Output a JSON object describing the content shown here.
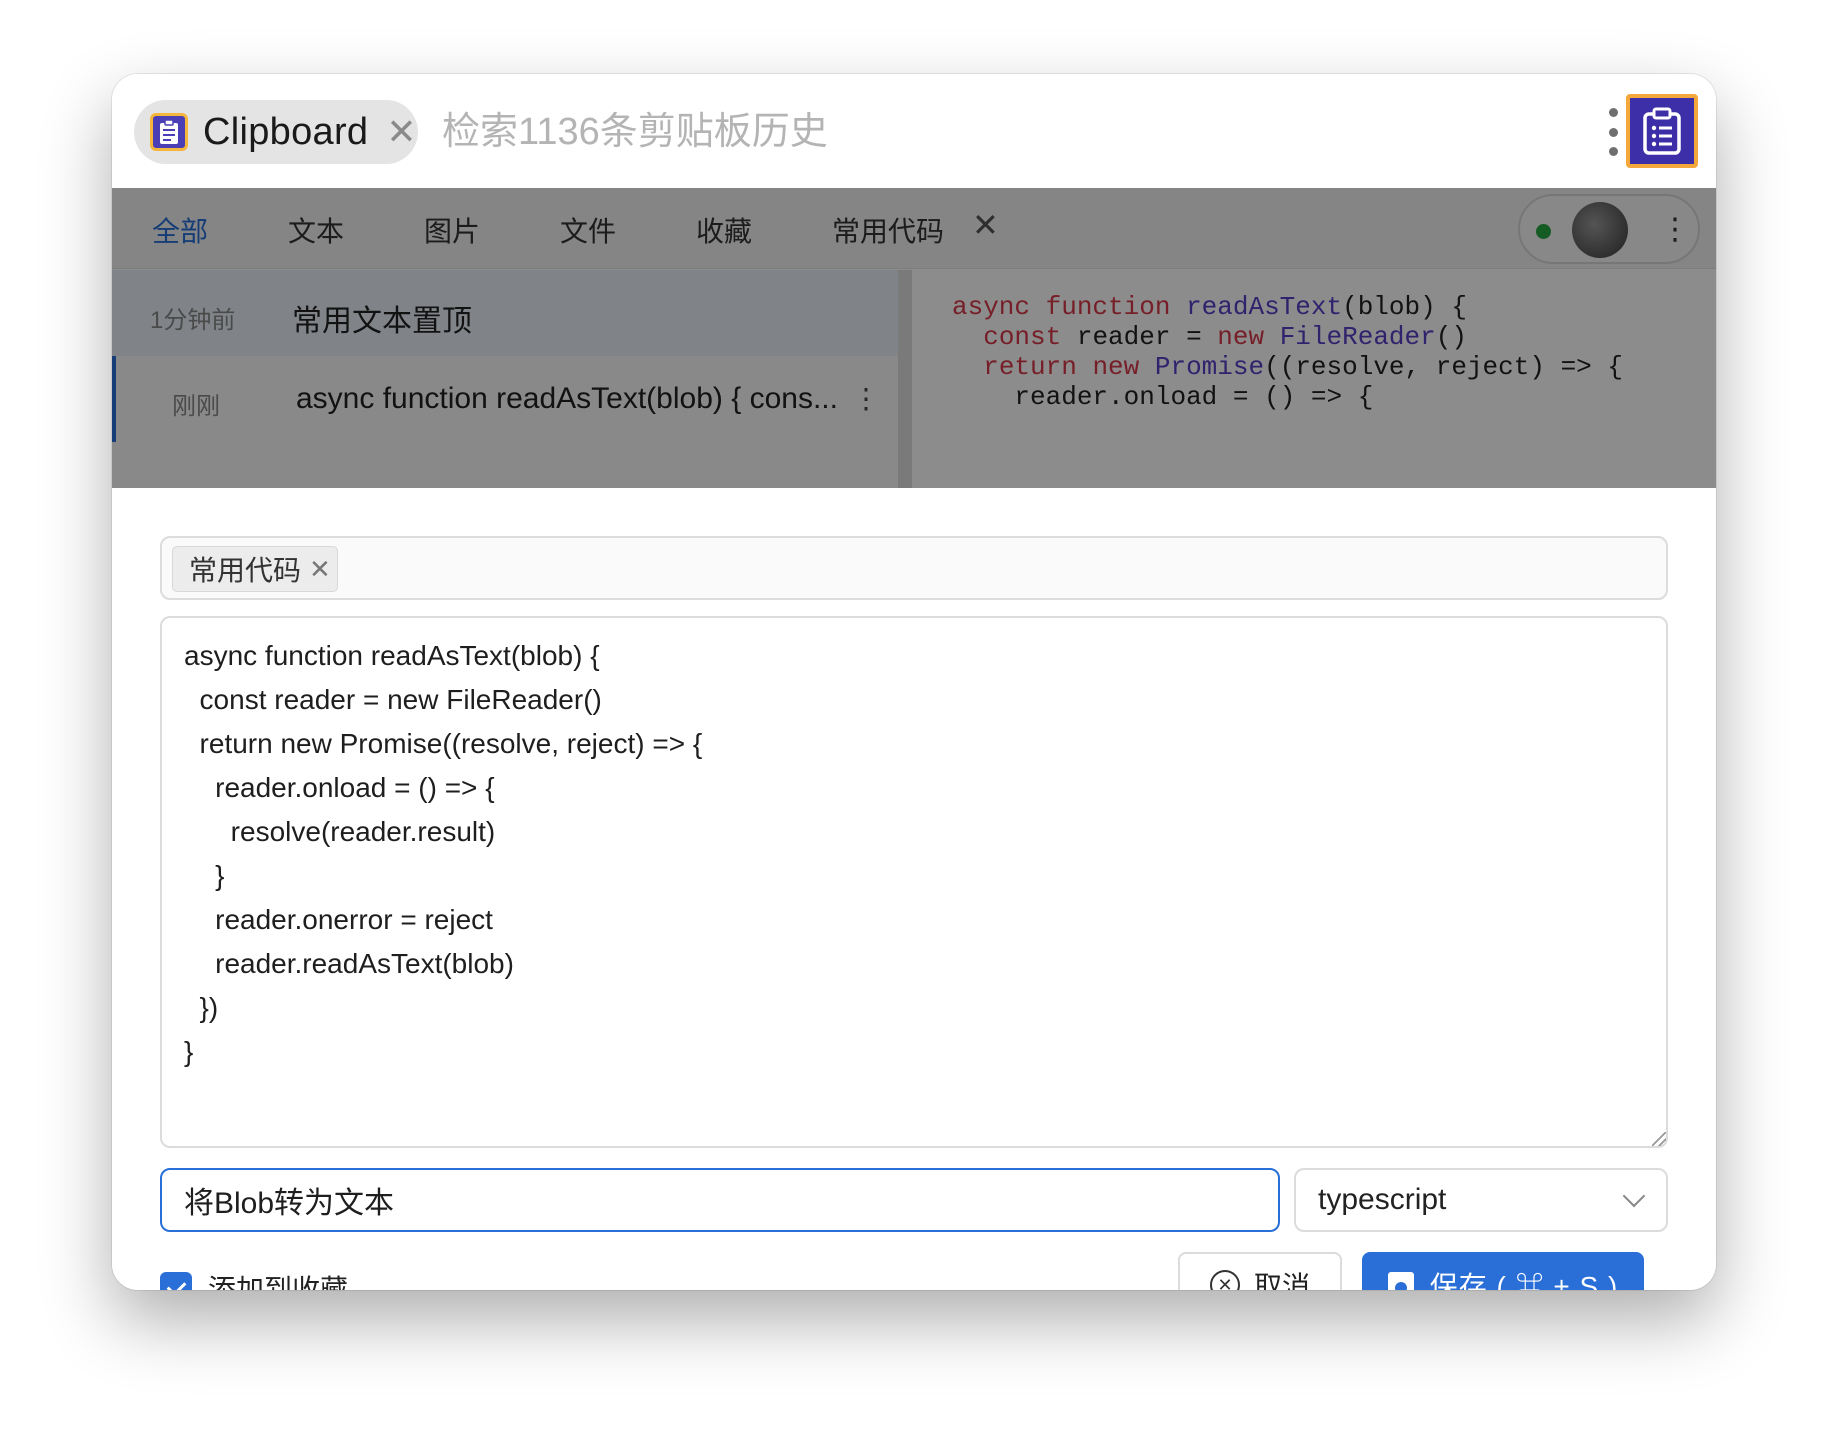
{
  "app": {
    "name": "Clipboard",
    "search_placeholder": "检索1136条剪贴板历史",
    "close_glyph": "✕"
  },
  "tabs": [
    {
      "label": "全部",
      "active": true
    },
    {
      "label": "文本"
    },
    {
      "label": "图片"
    },
    {
      "label": "文件"
    },
    {
      "label": "收藏"
    },
    {
      "label": "常用代码"
    }
  ],
  "tab_close_glyph": "✕",
  "list": [
    {
      "time": "1分钟前",
      "text": "常用文本置顶"
    },
    {
      "time": "刚刚",
      "text": "async function readAsText(blob) { cons..."
    }
  ],
  "preview_lines": [
    "async function readAsText(blob) {",
    "  const reader = new FileReader()",
    "  return new Promise((resolve, reject) => {",
    "    reader.onload = () => {"
  ],
  "dialog": {
    "tag": "常用代码",
    "tag_remove_glyph": "✕",
    "code": "async function readAsText(blob) {\n  const reader = new FileReader()\n  return new Promise((resolve, reject) => {\n    reader.onload = () => {\n      resolve(reader.result)\n    }\n    reader.onerror = reject\n    reader.readAsText(blob)\n  })\n}",
    "title_value": "将Blob转为文本",
    "language": "typescript",
    "favorite_label": "添加到收藏",
    "favorite_checked": true,
    "cancel_label": "取消",
    "save_label": "保存 ( ⌘ + S )"
  },
  "colors": {
    "accent": "#2a6fd8",
    "status_online": "#27a842",
    "brand_purple": "#3d2fa8",
    "brand_orange": "#f4a73b"
  },
  "icons": {
    "app": "clipboard-icon",
    "brand": "clipboard-list-icon",
    "menu": "more-vertical-icon",
    "cancel": "circle-x-icon",
    "save": "floppy-disk-icon",
    "select": "chevron-down-icon"
  }
}
